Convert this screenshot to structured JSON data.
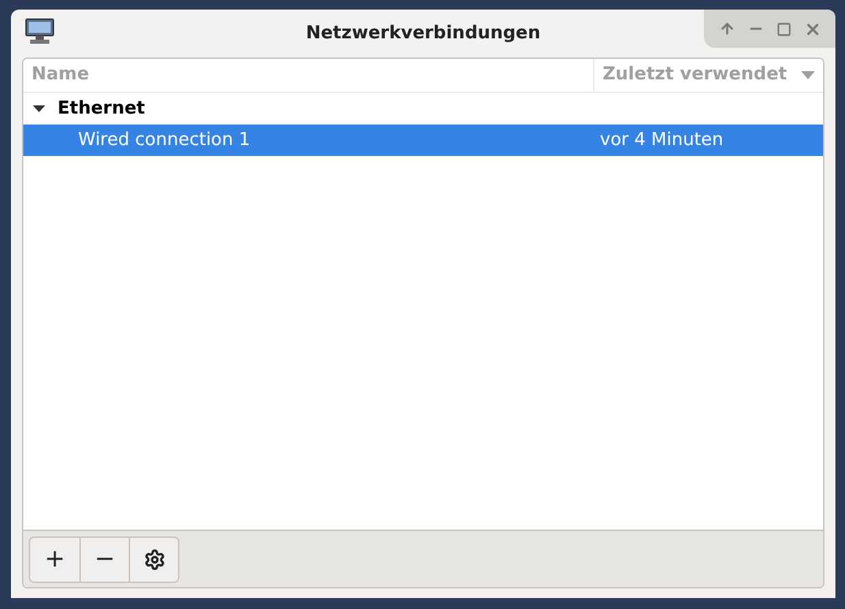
{
  "window": {
    "title": "Netzwerkverbindungen"
  },
  "table": {
    "columns": [
      {
        "label": "Name",
        "sorted": false
      },
      {
        "label": "Zuletzt verwendet",
        "sorted": true
      }
    ],
    "groups": [
      {
        "label": "Ethernet",
        "expanded": true,
        "rows": [
          {
            "name": "Wired connection 1",
            "last_used": "vor 4 Minuten",
            "selected": true
          }
        ]
      }
    ]
  },
  "toolbar": {
    "buttons": [
      {
        "kind": "text",
        "label": "+"
      },
      {
        "kind": "text",
        "label": "−"
      },
      {
        "kind": "settings"
      }
    ]
  }
}
